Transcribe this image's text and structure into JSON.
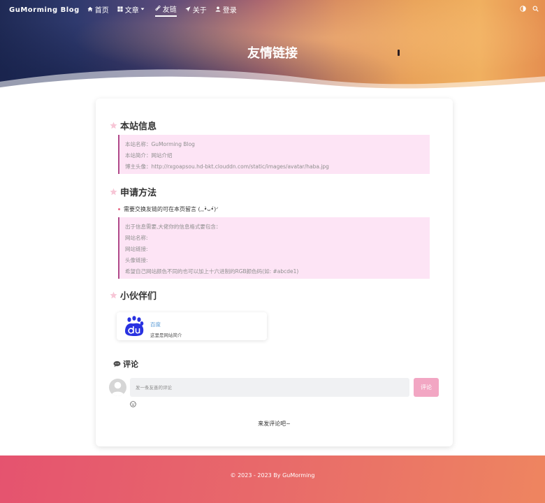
{
  "nav": {
    "brand": "GuMorming Blog",
    "items": [
      {
        "label": "首页"
      },
      {
        "label": "文章"
      },
      {
        "label": "友链"
      },
      {
        "label": "关于"
      },
      {
        "label": "登录"
      }
    ]
  },
  "hero": {
    "title": "友情链接"
  },
  "site_info": {
    "heading": "本站信息",
    "lines": [
      "本站名称：GuMorming Blog",
      "本站简介：网站介绍",
      "博主头像：http://rxgoapsou.hd-bkt.clouddn.com/static/images/avatar/haba.jpg"
    ]
  },
  "apply": {
    "heading": "申请方法",
    "bullet": "需要交换友链的可在本页留言 (,,•̀ᴗ•́)ᐟ",
    "lines": [
      "出于信息需要,大佬你的信息格式要包含：",
      "网站名称:",
      "网站链接:",
      "头像链接:",
      "希望自己网站颜色不同的也可以加上十六进制的RGB颜色码(如: #abcde1)"
    ]
  },
  "partners": {
    "heading": "小伙伴们",
    "friends": [
      {
        "name": "百度",
        "desc": "这里是网站简介",
        "icon": "baidu-logo"
      }
    ]
  },
  "comments": {
    "heading": "评论",
    "placeholder": "发一条友善的评论",
    "submit": "评论",
    "empty": "来发评论吧~"
  },
  "footer": {
    "text": "© 2023 - 2023 By GuMorming"
  },
  "colors": {
    "accent": "#e86a86",
    "quote_bg": "#fde4f5",
    "quote_border": "#b04a8a",
    "submit_bg": "#f2a6c3",
    "link": "#5a9bd6"
  }
}
